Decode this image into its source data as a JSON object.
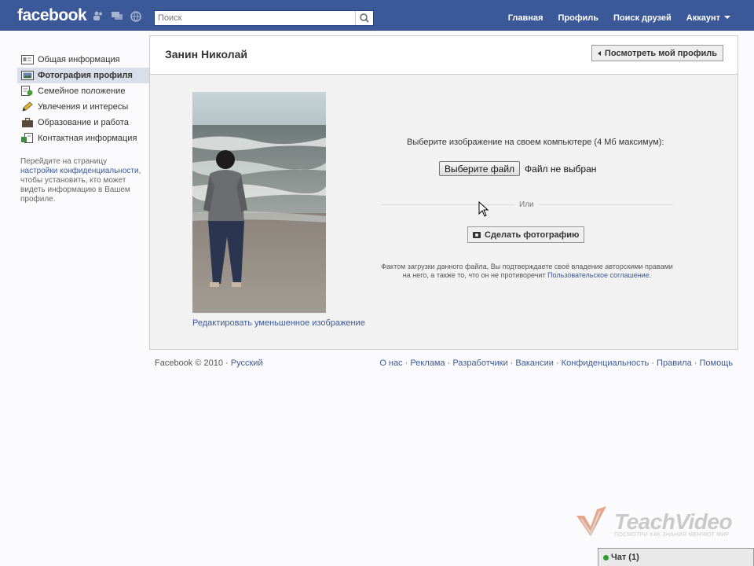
{
  "topbar": {
    "logo": "facebook",
    "search": {
      "placeholder": "Поиск"
    },
    "nav": [
      "Главная",
      "Профиль",
      "Поиск друзей",
      "Аккаунт"
    ]
  },
  "sidebar": {
    "items": [
      {
        "label": "Общая информация",
        "icon": "id-card-icon",
        "active": false
      },
      {
        "label": "Фотография профиля",
        "icon": "photo-icon",
        "active": true
      },
      {
        "label": "Семейное положение",
        "icon": "family-icon",
        "active": false
      },
      {
        "label": "Увлечения и интересы",
        "icon": "pencil-icon",
        "active": false
      },
      {
        "label": "Образование и работа",
        "icon": "briefcase-icon",
        "active": false
      },
      {
        "label": "Контактная информация",
        "icon": "contact-icon",
        "active": false
      }
    ],
    "note": {
      "before": "Перейдите на страницу ",
      "link": "настройки конфиденциальности",
      "after": ", чтобы установить, кто может видеть информацию в Вашем профиле."
    }
  },
  "main": {
    "title": "Занин Николай",
    "view_profile": "Посмотреть мой профиль",
    "edit_thumbnail": "Редактировать уменьшенное изображение",
    "choose_text": "Выберите изображение на своем компьютере (4 Мб максимум):",
    "file_button": "Выберите файл",
    "file_status": "Файл не выбран",
    "or": "Или",
    "take_photo": "Сделать фотографию",
    "legal": {
      "text": "Фактом загрузки данного файла, Вы подтверждаете своё владение авторскими правами на него, а также то, что он не противоречит ",
      "link": "Пользовательское соглашение",
      "end": "."
    }
  },
  "footer": {
    "copyright": "Facebook © 2010 ·",
    "language": "Русский",
    "links": [
      "О нас",
      "Реклама",
      "Разработчики",
      "Вакансии",
      "Конфиденциальность",
      "Правила",
      "Помощь"
    ]
  },
  "watermark": {
    "name": "TeachVideo",
    "tagline": "ПОСМОТРИ КАК ЗНАНИЯ МЕНЯЮТ МИР"
  },
  "chat": {
    "label": "Чат (1)"
  },
  "colors": {
    "brand": "#3b5998",
    "active_bg": "#d8dfea",
    "online": "#2f9e2f"
  }
}
